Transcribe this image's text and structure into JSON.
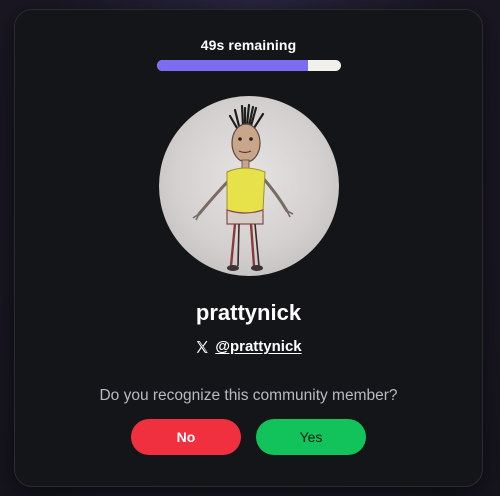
{
  "timer": {
    "label": "49s remaining",
    "progress_fraction": 0.82
  },
  "profile": {
    "avatar_icon": "avatar-drawing",
    "username": "prattynick",
    "platform_icon": "x-logo-icon",
    "handle": "@prattynick"
  },
  "prompt": {
    "question": "Do you recognize this community member?",
    "no_label": "No",
    "yes_label": "Yes"
  },
  "colors": {
    "progress": "#7c6cf0",
    "progress_track": "#f2f0ea",
    "no_button": "#f0303f",
    "yes_button": "#11c35a",
    "card": "#141519"
  }
}
